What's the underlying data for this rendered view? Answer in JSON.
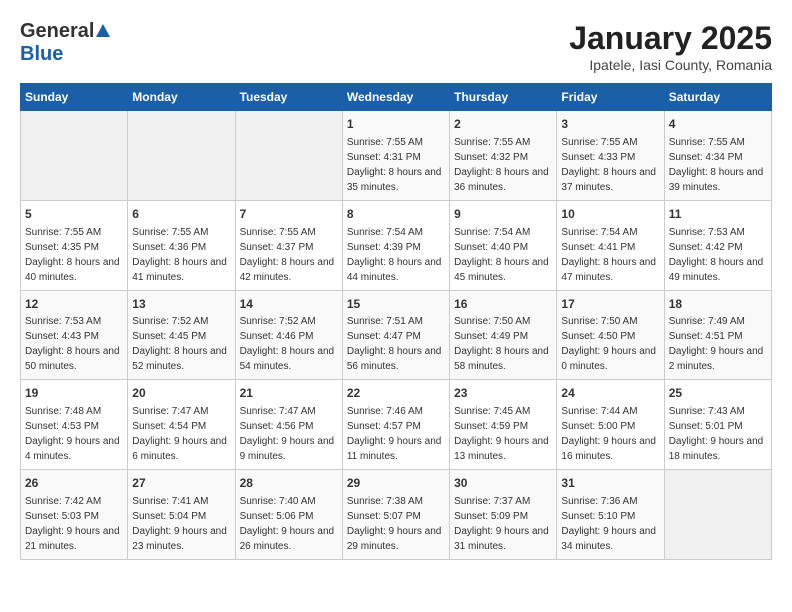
{
  "header": {
    "logo_general": "General",
    "logo_blue": "Blue",
    "title": "January 2025",
    "subtitle": "Ipatele, Iasi County, Romania"
  },
  "weekdays": [
    "Sunday",
    "Monday",
    "Tuesday",
    "Wednesday",
    "Thursday",
    "Friday",
    "Saturday"
  ],
  "weeks": [
    [
      {
        "day": "",
        "sunrise": "",
        "sunset": "",
        "daylight": ""
      },
      {
        "day": "",
        "sunrise": "",
        "sunset": "",
        "daylight": ""
      },
      {
        "day": "",
        "sunrise": "",
        "sunset": "",
        "daylight": ""
      },
      {
        "day": "1",
        "sunrise": "Sunrise: 7:55 AM",
        "sunset": "Sunset: 4:31 PM",
        "daylight": "Daylight: 8 hours and 35 minutes."
      },
      {
        "day": "2",
        "sunrise": "Sunrise: 7:55 AM",
        "sunset": "Sunset: 4:32 PM",
        "daylight": "Daylight: 8 hours and 36 minutes."
      },
      {
        "day": "3",
        "sunrise": "Sunrise: 7:55 AM",
        "sunset": "Sunset: 4:33 PM",
        "daylight": "Daylight: 8 hours and 37 minutes."
      },
      {
        "day": "4",
        "sunrise": "Sunrise: 7:55 AM",
        "sunset": "Sunset: 4:34 PM",
        "daylight": "Daylight: 8 hours and 39 minutes."
      }
    ],
    [
      {
        "day": "5",
        "sunrise": "Sunrise: 7:55 AM",
        "sunset": "Sunset: 4:35 PM",
        "daylight": "Daylight: 8 hours and 40 minutes."
      },
      {
        "day": "6",
        "sunrise": "Sunrise: 7:55 AM",
        "sunset": "Sunset: 4:36 PM",
        "daylight": "Daylight: 8 hours and 41 minutes."
      },
      {
        "day": "7",
        "sunrise": "Sunrise: 7:55 AM",
        "sunset": "Sunset: 4:37 PM",
        "daylight": "Daylight: 8 hours and 42 minutes."
      },
      {
        "day": "8",
        "sunrise": "Sunrise: 7:54 AM",
        "sunset": "Sunset: 4:39 PM",
        "daylight": "Daylight: 8 hours and 44 minutes."
      },
      {
        "day": "9",
        "sunrise": "Sunrise: 7:54 AM",
        "sunset": "Sunset: 4:40 PM",
        "daylight": "Daylight: 8 hours and 45 minutes."
      },
      {
        "day": "10",
        "sunrise": "Sunrise: 7:54 AM",
        "sunset": "Sunset: 4:41 PM",
        "daylight": "Daylight: 8 hours and 47 minutes."
      },
      {
        "day": "11",
        "sunrise": "Sunrise: 7:53 AM",
        "sunset": "Sunset: 4:42 PM",
        "daylight": "Daylight: 8 hours and 49 minutes."
      }
    ],
    [
      {
        "day": "12",
        "sunrise": "Sunrise: 7:53 AM",
        "sunset": "Sunset: 4:43 PM",
        "daylight": "Daylight: 8 hours and 50 minutes."
      },
      {
        "day": "13",
        "sunrise": "Sunrise: 7:52 AM",
        "sunset": "Sunset: 4:45 PM",
        "daylight": "Daylight: 8 hours and 52 minutes."
      },
      {
        "day": "14",
        "sunrise": "Sunrise: 7:52 AM",
        "sunset": "Sunset: 4:46 PM",
        "daylight": "Daylight: 8 hours and 54 minutes."
      },
      {
        "day": "15",
        "sunrise": "Sunrise: 7:51 AM",
        "sunset": "Sunset: 4:47 PM",
        "daylight": "Daylight: 8 hours and 56 minutes."
      },
      {
        "day": "16",
        "sunrise": "Sunrise: 7:50 AM",
        "sunset": "Sunset: 4:49 PM",
        "daylight": "Daylight: 8 hours and 58 minutes."
      },
      {
        "day": "17",
        "sunrise": "Sunrise: 7:50 AM",
        "sunset": "Sunset: 4:50 PM",
        "daylight": "Daylight: 9 hours and 0 minutes."
      },
      {
        "day": "18",
        "sunrise": "Sunrise: 7:49 AM",
        "sunset": "Sunset: 4:51 PM",
        "daylight": "Daylight: 9 hours and 2 minutes."
      }
    ],
    [
      {
        "day": "19",
        "sunrise": "Sunrise: 7:48 AM",
        "sunset": "Sunset: 4:53 PM",
        "daylight": "Daylight: 9 hours and 4 minutes."
      },
      {
        "day": "20",
        "sunrise": "Sunrise: 7:47 AM",
        "sunset": "Sunset: 4:54 PM",
        "daylight": "Daylight: 9 hours and 6 minutes."
      },
      {
        "day": "21",
        "sunrise": "Sunrise: 7:47 AM",
        "sunset": "Sunset: 4:56 PM",
        "daylight": "Daylight: 9 hours and 9 minutes."
      },
      {
        "day": "22",
        "sunrise": "Sunrise: 7:46 AM",
        "sunset": "Sunset: 4:57 PM",
        "daylight": "Daylight: 9 hours and 11 minutes."
      },
      {
        "day": "23",
        "sunrise": "Sunrise: 7:45 AM",
        "sunset": "Sunset: 4:59 PM",
        "daylight": "Daylight: 9 hours and 13 minutes."
      },
      {
        "day": "24",
        "sunrise": "Sunrise: 7:44 AM",
        "sunset": "Sunset: 5:00 PM",
        "daylight": "Daylight: 9 hours and 16 minutes."
      },
      {
        "day": "25",
        "sunrise": "Sunrise: 7:43 AM",
        "sunset": "Sunset: 5:01 PM",
        "daylight": "Daylight: 9 hours and 18 minutes."
      }
    ],
    [
      {
        "day": "26",
        "sunrise": "Sunrise: 7:42 AM",
        "sunset": "Sunset: 5:03 PM",
        "daylight": "Daylight: 9 hours and 21 minutes."
      },
      {
        "day": "27",
        "sunrise": "Sunrise: 7:41 AM",
        "sunset": "Sunset: 5:04 PM",
        "daylight": "Daylight: 9 hours and 23 minutes."
      },
      {
        "day": "28",
        "sunrise": "Sunrise: 7:40 AM",
        "sunset": "Sunset: 5:06 PM",
        "daylight": "Daylight: 9 hours and 26 minutes."
      },
      {
        "day": "29",
        "sunrise": "Sunrise: 7:38 AM",
        "sunset": "Sunset: 5:07 PM",
        "daylight": "Daylight: 9 hours and 29 minutes."
      },
      {
        "day": "30",
        "sunrise": "Sunrise: 7:37 AM",
        "sunset": "Sunset: 5:09 PM",
        "daylight": "Daylight: 9 hours and 31 minutes."
      },
      {
        "day": "31",
        "sunrise": "Sunrise: 7:36 AM",
        "sunset": "Sunset: 5:10 PM",
        "daylight": "Daylight: 9 hours and 34 minutes."
      },
      {
        "day": "",
        "sunrise": "",
        "sunset": "",
        "daylight": ""
      }
    ]
  ]
}
